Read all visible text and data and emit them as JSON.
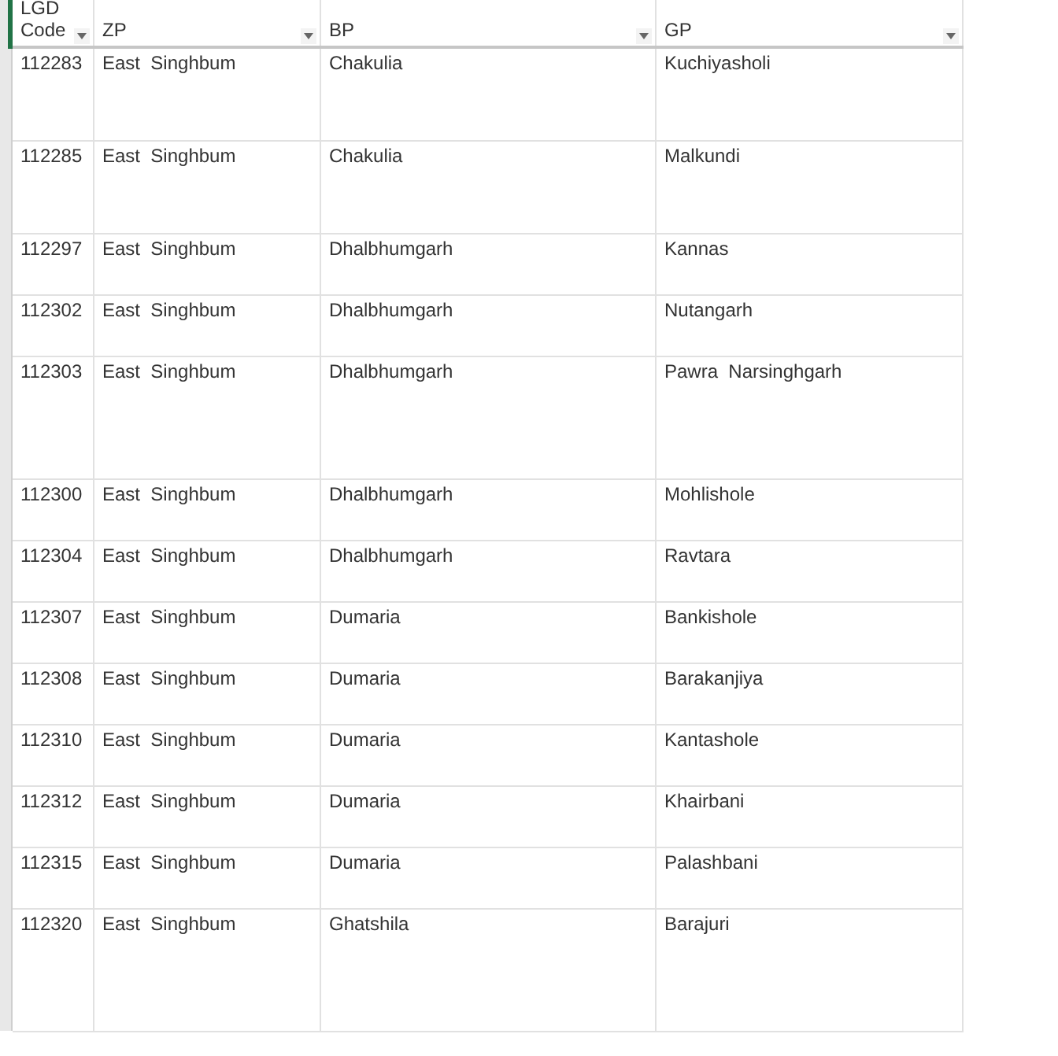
{
  "columns": [
    "LGD Code",
    "ZP",
    "BP",
    "GP"
  ],
  "rows": [
    [
      "112283",
      "East  Singhbum",
      "Chakulia",
      "Kuchiyasholi"
    ],
    [
      "112285",
      "East  Singhbum",
      "Chakulia",
      "Malkundi"
    ],
    [
      "112297",
      "East  Singhbum",
      "Dhalbhumgarh",
      "Kannas"
    ],
    [
      "112302",
      "East  Singhbum",
      "Dhalbhumgarh",
      "Nutangarh"
    ],
    [
      "112303",
      "East  Singhbum",
      "Dhalbhumgarh",
      "Pawra  Narsinghgarh"
    ],
    [
      "112300",
      "East  Singhbum",
      "Dhalbhumgarh",
      "Mohlishole"
    ],
    [
      "112304",
      "East  Singhbum",
      "Dhalbhumgarh",
      "Ravtara"
    ],
    [
      "112307",
      "East  Singhbum",
      "Dumaria",
      "Bankishole"
    ],
    [
      "112308",
      "East  Singhbum",
      "Dumaria",
      "Barakanjiya"
    ],
    [
      "112310",
      "East  Singhbum",
      "Dumaria",
      "Kantashole"
    ],
    [
      "112312",
      "East  Singhbum",
      "Dumaria",
      "Khairbani"
    ],
    [
      "112315",
      "East  Singhbum",
      "Dumaria",
      "Palashbani"
    ],
    [
      "112320",
      "East  Singhbum",
      "Ghatshila",
      "Barajuri"
    ]
  ]
}
